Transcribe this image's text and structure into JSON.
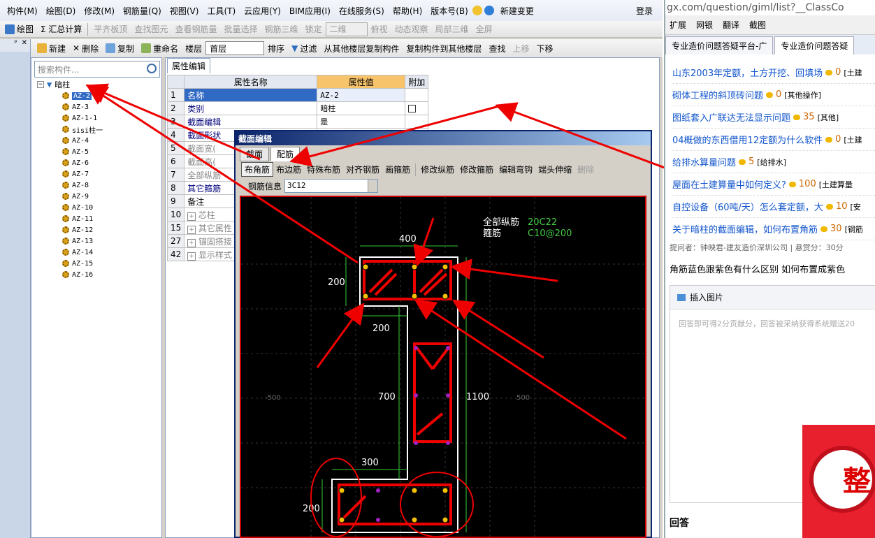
{
  "menubar": {
    "items": [
      "构件(M)",
      "绘图(D)",
      "修改(M)",
      "钢筋量(Q)",
      "视图(V)",
      "工具(T)",
      "云应用(Y)",
      "BIM应用(I)",
      "在线服务(S)",
      "帮助(H)",
      "版本号(B)",
      "新建变更"
    ],
    "login": "登录"
  },
  "toolbar1": {
    "items": [
      "绘图",
      "Σ 汇总计算",
      "平齐板顶",
      "查找图元",
      "查看钢筋量",
      "批量选择",
      "钢筋三维",
      "锁定",
      "二维",
      "俯视",
      "动态观察",
      "局部三维",
      "全屏"
    ]
  },
  "toolbar2": {
    "items": [
      "新建",
      "删除",
      "复制",
      "重命名",
      "楼层",
      "首层",
      "排序",
      "过滤",
      "从其他楼层复制构件",
      "复制构件到其他楼层",
      "查找",
      "上移",
      "下移"
    ]
  },
  "navigator": {
    "search_placeholder": "搜索构件...",
    "root": "暗柱",
    "items": [
      "AZ-2",
      "AZ-3",
      "AZ-1-1",
      "sisi柱一",
      "AZ-4",
      "AZ-5",
      "AZ-6",
      "AZ-7",
      "AZ-8",
      "AZ-9",
      "AZ-10",
      "AZ-11",
      "AZ-12",
      "AZ-13",
      "AZ-14",
      "AZ-15",
      "AZ-16"
    ],
    "selected": "AZ-2"
  },
  "properties": {
    "tab": "属性编辑",
    "headers": [
      "属性名称",
      "属性值",
      "附加"
    ],
    "rows": [
      {
        "num": "1",
        "name": "名称",
        "value": "AZ-2"
      },
      {
        "num": "2",
        "name": "类别",
        "value": "暗柱"
      },
      {
        "num": "3",
        "name": "截面编辑",
        "value": "是"
      },
      {
        "num": "4",
        "name": "截面形状",
        "value": ""
      },
      {
        "num": "5",
        "name": "截面宽(",
        "value": ""
      },
      {
        "num": "6",
        "name": "截面高(",
        "value": ""
      },
      {
        "num": "7",
        "name": "全部纵筋",
        "value": ""
      },
      {
        "num": "8",
        "name": "其它箍筋",
        "value": ""
      },
      {
        "num": "9",
        "name": "备注",
        "value": ""
      },
      {
        "num": "10",
        "name": "芯柱",
        "value": ""
      },
      {
        "num": "15",
        "name": "其它属性",
        "value": ""
      },
      {
        "num": "27",
        "name": "锚固搭接",
        "value": ""
      },
      {
        "num": "42",
        "name": "显示样式",
        "value": ""
      }
    ]
  },
  "dialog": {
    "title": "截面编辑",
    "tabs": [
      "截面",
      "配筋"
    ],
    "tools": [
      "布角筋",
      "布边筋",
      "特殊布筋",
      "对齐钢筋",
      "画箍筋",
      "修改纵筋",
      "修改箍筋",
      "编辑弯钩",
      "端头伸缩",
      "删除"
    ],
    "info_label": "钢筋信息",
    "info_value": "3C12",
    "drawing": {
      "label_long": "全部纵筋",
      "label_stirrup": "箍筋",
      "value_long": "20C22",
      "value_stirrup": "C10@200",
      "dims": [
        "400",
        "200",
        "200",
        "700",
        "1100",
        "300",
        "200"
      ],
      "axis_left": "-500",
      "axis_right": "500"
    }
  },
  "browser": {
    "url": "gx.com/question/giml/list?__ClassCo",
    "tools": [
      "扩展",
      "网银",
      "翻译",
      "截图"
    ],
    "tabs": [
      "专业造价问题答疑平台-广",
      "专业造价问题答疑"
    ],
    "questions": [
      {
        "title": "山东2003年定额，土方开挖、回填场",
        "points": "0",
        "cat": "[土建"
      },
      {
        "title": "砌体工程的斜顶砖问题",
        "points": "0",
        "cat": "[其他操作]"
      },
      {
        "title": "图纸套入广联达无法显示问题",
        "points": "35",
        "cat": "[其他]"
      },
      {
        "title": "04概做的东西借用12定额为什么软件",
        "points": "0",
        "cat": "[土建"
      },
      {
        "title": "给排水算量问题",
        "points": "5",
        "cat": "[给排水]"
      },
      {
        "title": "屋面在土建算量中如何定义?",
        "points": "100",
        "cat": "[土建算量"
      },
      {
        "title": "自控设备（60吨/天）怎么套定额，大",
        "points": "10",
        "cat": "[安"
      },
      {
        "title": "关于暗柱的截面编辑，如何布置角筋",
        "points": "30",
        "cat": "[钢筋"
      }
    ],
    "asker": "提问者：钟映君-建友造价深圳公司  |  悬赏分：30分",
    "question_text": "角筋蓝色跟紫色有什么区别 如何布置成紫色",
    "insert_image": "插入图片",
    "answer_placeholder": "回答即可得2分贡献分，回答被采纳获得系统赠送20",
    "answer_label": "回答",
    "promo_text": "整"
  }
}
